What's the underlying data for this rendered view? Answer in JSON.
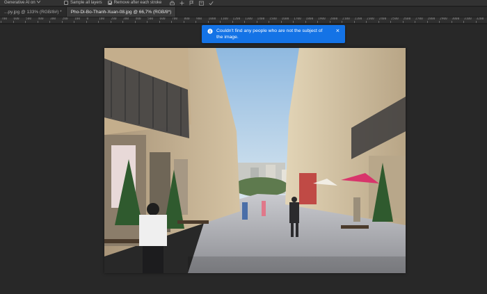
{
  "options_bar": {
    "tool_preset": "Generative AI on",
    "sample_all_layers": {
      "label": "Sample all layers",
      "checked": false
    },
    "remove_after_stroke": {
      "label": "Remove after each stroke",
      "checked": true
    },
    "icons": [
      "brush-settings-icon",
      "plus-icon",
      "flag-icon",
      "undo-icon",
      "check-icon"
    ]
  },
  "tabs": [
    {
      "label": "...py.jpg @ 133% (RGB/8#) *",
      "active": false
    },
    {
      "label": "Pho-Di-Bo-Thanh-Xuan-08.jpg @ 66,7% (RGB/8*)",
      "active": true
    }
  ],
  "ruler": {
    "ticks": [
      "700",
      "600",
      "500",
      "400",
      "300",
      "200",
      "100",
      "0",
      "100",
      "200",
      "300",
      "400",
      "500",
      "600",
      "700",
      "800",
      "900",
      "1000",
      "1100",
      "1200",
      "1300",
      "1400",
      "1500",
      "1600",
      "1700",
      "1800",
      "1900",
      "2000",
      "2100",
      "2200",
      "2300",
      "2400",
      "2500",
      "2600",
      "2700",
      "2800",
      "2900",
      "3000",
      "3100",
      "3200"
    ]
  },
  "notification": {
    "message": "Couldn't find any people who are not the subject of the image.",
    "icon": "info-icon",
    "close_symbol": "×",
    "color": "#1473e6"
  },
  "document": {
    "description_colors": {
      "sky": "#9cc4e6",
      "building_left": "#cbb79a",
      "building_right": "#d4c4a6",
      "street": "#b9b9bd"
    }
  }
}
